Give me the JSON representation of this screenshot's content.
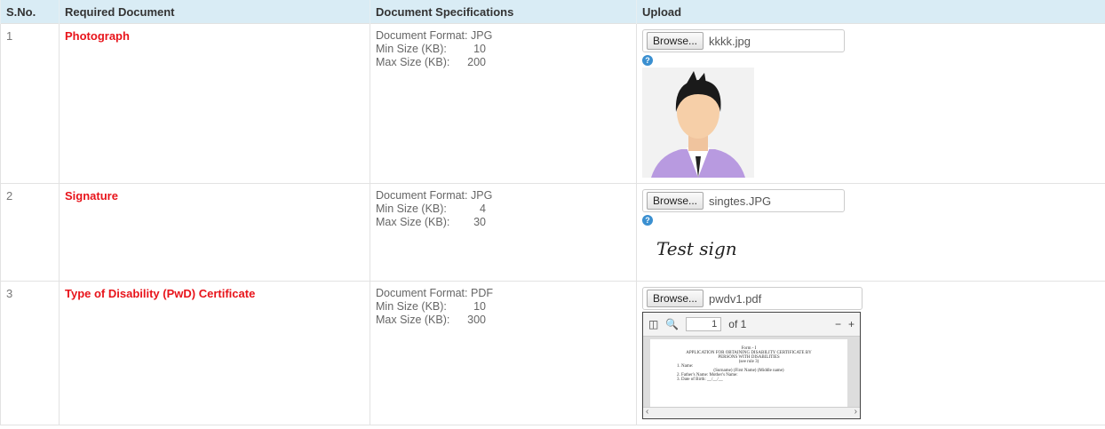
{
  "headers": {
    "sno": "S.No.",
    "doc": "Required Document",
    "spec": "Document Specifications",
    "upload": "Upload"
  },
  "rows": [
    {
      "sno": "1",
      "name": "Photograph",
      "format_label": "Document Format:",
      "format": "JPG",
      "min_label": "Min Size (KB):",
      "min": "10",
      "max_label": "Max Size (KB):",
      "max": "200",
      "browse": "Browse...",
      "file": "kkkk.jpg"
    },
    {
      "sno": "2",
      "name": "Signature",
      "format_label": "Document Format:",
      "format": "JPG",
      "min_label": "Min Size (KB):",
      "min": "4",
      "max_label": "Max Size (KB):",
      "max": "30",
      "browse": "Browse...",
      "file": "singtes.JPG",
      "signature_text": "Test sign"
    },
    {
      "sno": "3",
      "name": "Type of Disability (PwD) Certificate",
      "format_label": "Document Format:",
      "format": "PDF",
      "min_label": "Min Size (KB):",
      "min": "10",
      "max_label": "Max Size (KB):",
      "max": "300",
      "browse": "Browse...",
      "file": "pwdv1.pdf"
    }
  ],
  "pdf_viewer": {
    "page_number": "1",
    "page_total": "of 1",
    "page_lines": [
      "Form - I",
      "APPLICATION FOR OBTAINING DISABILITY CERTIFICATE BY",
      "PERSONS WITH DISABILITIES",
      "(see rule 3)",
      "1. Name:",
      "(Surname)  (First Name)  (Middle name)",
      "2. Father's Name:  Mother's Name:",
      "3. Date of Birth: __/__/__"
    ]
  },
  "help_glyph": "?",
  "colors": {
    "header_bg": "#d9ecf5",
    "doc_name": "#e8141b",
    "help_icon": "#3a8fd0"
  }
}
